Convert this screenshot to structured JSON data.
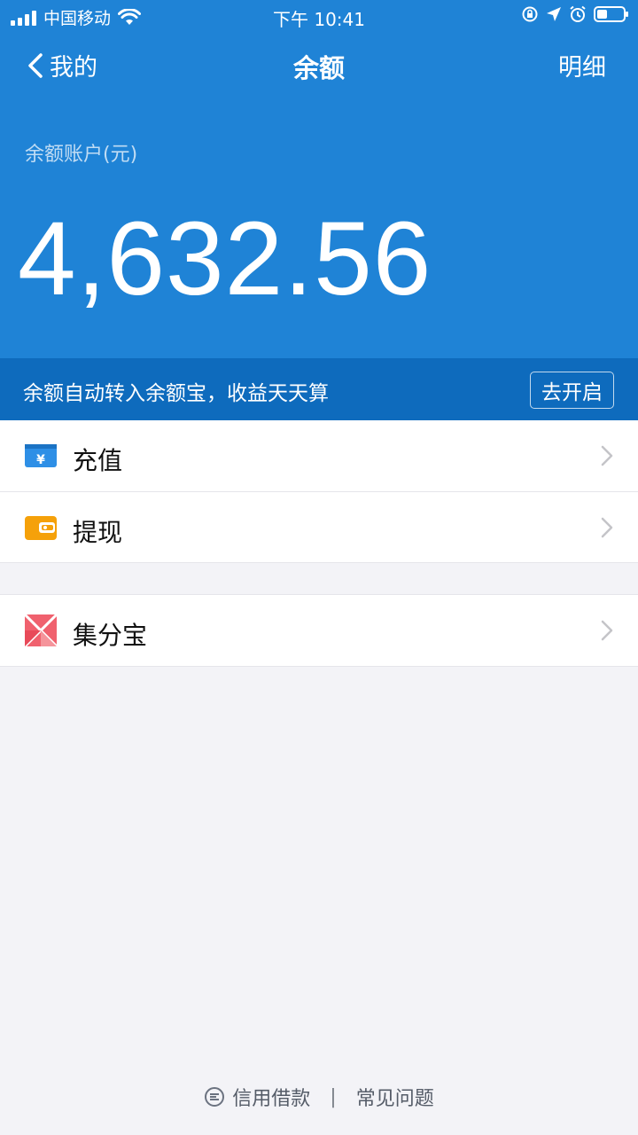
{
  "status_bar": {
    "carrier": "中国移动",
    "time": "下午 10:41"
  },
  "nav": {
    "back_label": "我的",
    "title": "余额",
    "detail_label": "明细"
  },
  "balance": {
    "label": "余额账户(元)",
    "amount": "4,632.56"
  },
  "promo": {
    "text": "余额自动转入余额宝，收益天天算",
    "button": "去开启"
  },
  "menu": [
    {
      "label": "充值",
      "icon": "yuan-card-icon",
      "color": "#2e8fe6"
    },
    {
      "label": "提现",
      "icon": "wallet-icon",
      "color": "#f5a10a"
    },
    {
      "label": "集分宝",
      "icon": "jifenbao-icon",
      "color": "#f0616e"
    }
  ],
  "footer": {
    "loan": "信用借款",
    "faq": "常见问题"
  },
  "colors": {
    "header_blue": "#1f83d6",
    "promo_blue": "#0e6bbd",
    "background": "#f3f3f7"
  }
}
